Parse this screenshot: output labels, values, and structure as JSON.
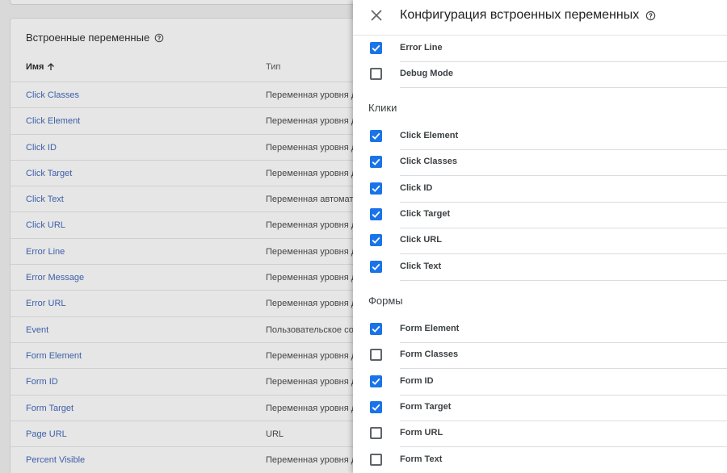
{
  "background": {
    "card_title": "Встроенные переменные",
    "col_name": "Имя",
    "col_type": "Тип",
    "rows": [
      {
        "name": "Click Classes",
        "type": "Переменная уровня д"
      },
      {
        "name": "Click Element",
        "type": "Переменная уровня д"
      },
      {
        "name": "Click ID",
        "type": "Переменная уровня д"
      },
      {
        "name": "Click Target",
        "type": "Переменная уровня д"
      },
      {
        "name": "Click Text",
        "type": "Переменная автомат"
      },
      {
        "name": "Click URL",
        "type": "Переменная уровня д"
      },
      {
        "name": "Error Line",
        "type": "Переменная уровня д"
      },
      {
        "name": "Error Message",
        "type": "Переменная уровня д"
      },
      {
        "name": "Error URL",
        "type": "Переменная уровня д"
      },
      {
        "name": "Event",
        "type": "Пользовательское со"
      },
      {
        "name": "Form Element",
        "type": "Переменная уровня д"
      },
      {
        "name": "Form ID",
        "type": "Переменная уровня д"
      },
      {
        "name": "Form Target",
        "type": "Переменная уровня д"
      },
      {
        "name": "Page URL",
        "type": "URL"
      },
      {
        "name": "Percent Visible",
        "type": "Переменная уровня д"
      }
    ]
  },
  "panel": {
    "title": "Конфигурация встроенных переменных",
    "top_items": [
      {
        "label": "Error Line",
        "checked": true
      },
      {
        "label": "Debug Mode",
        "checked": false
      }
    ],
    "sections": [
      {
        "title": "Клики",
        "items": [
          {
            "label": "Click Element",
            "checked": true
          },
          {
            "label": "Click Classes",
            "checked": true
          },
          {
            "label": "Click ID",
            "checked": true
          },
          {
            "label": "Click Target",
            "checked": true
          },
          {
            "label": "Click URL",
            "checked": true
          },
          {
            "label": "Click Text",
            "checked": true
          }
        ]
      },
      {
        "title": "Формы",
        "items": [
          {
            "label": "Form Element",
            "checked": true
          },
          {
            "label": "Form Classes",
            "checked": false
          },
          {
            "label": "Form ID",
            "checked": true
          },
          {
            "label": "Form Target",
            "checked": true
          },
          {
            "label": "Form URL",
            "checked": false
          },
          {
            "label": "Form Text",
            "checked": false
          }
        ]
      }
    ]
  },
  "colors": {
    "checkbox_checked": "#1a73e8",
    "link": "#3d5fa8"
  }
}
